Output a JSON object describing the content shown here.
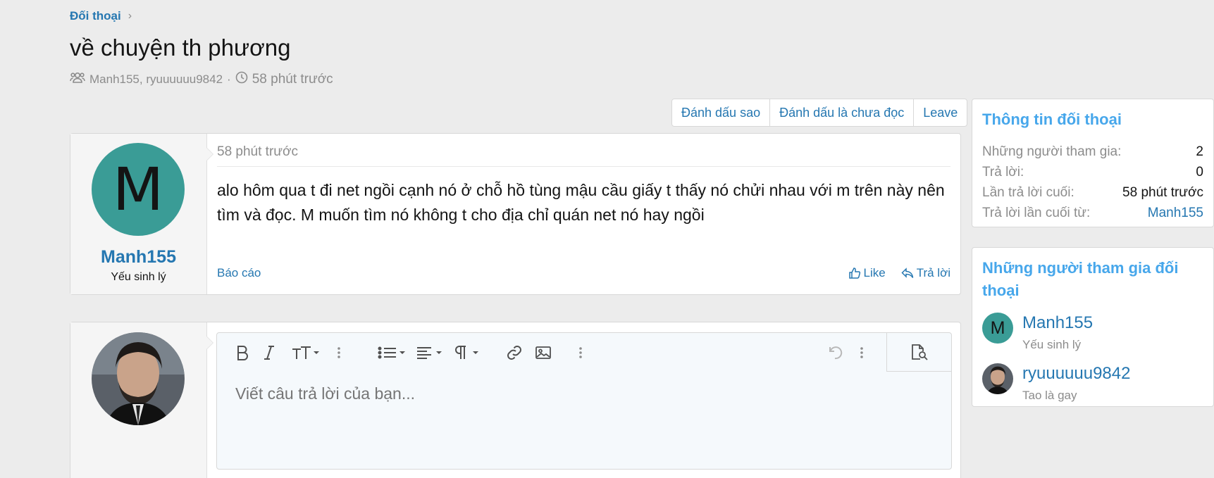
{
  "breadcrumb": {
    "label": "Đối thoại",
    "chevron": "›"
  },
  "page": {
    "title": "về chuyện th phương"
  },
  "meta": {
    "participants": "Manh155, ryuuuuuu9842",
    "separator": "·",
    "time": "58 phút trước"
  },
  "actions": [
    {
      "label": "Đánh dấu sao"
    },
    {
      "label": "Đánh dấu là chưa đọc"
    },
    {
      "label": "Leave"
    }
  ],
  "message": {
    "avatar_letter": "M",
    "username": "Manh155",
    "user_title": "Yếu sinh lý",
    "time": "58 phút trước",
    "body": "alo hôm qua t đi net ngồi cạnh nó ở chỗ hồ tùng mậu cầu giấy t thấy nó chửi nhau với m trên này nên tìm và đọc. M muốn tìm nó không t cho địa chỉ quán net nó hay ngồi",
    "report": "Báo cáo",
    "like": "Like",
    "reply": "Trả lời"
  },
  "editor": {
    "placeholder": "Viết câu trả lời của bạn...",
    "tools": [
      "bold-icon",
      "italic-icon",
      "text-size-icon",
      "more-vertical-icon",
      "list-icon",
      "align-icon",
      "paragraph-icon",
      "link-icon",
      "image-icon",
      "more-vertical-icon",
      "undo-icon",
      "more-vertical-icon",
      "preview-icon"
    ]
  },
  "info": {
    "title": "Thông tin đối thoại",
    "rows": [
      {
        "label": "Những người tham gia:",
        "value": "2"
      },
      {
        "label": "Trả lời:",
        "value": "0"
      },
      {
        "label": "Lần trả lời cuối:",
        "value": "58 phút trước"
      },
      {
        "label": "Trả lời lần cuối từ:",
        "value": "Manh155"
      }
    ]
  },
  "participants": {
    "title": "Những người tham gia đối thoại",
    "list": [
      {
        "letter": "M",
        "name": "Manh155",
        "title": "Yếu sinh lý"
      },
      {
        "name": "ryuuuuuu9842",
        "title": "Tao là gay"
      }
    ]
  },
  "colors": {
    "link": "#2577b1",
    "accent_title": "#47a7eb",
    "avatar_bg": "#3a9c96",
    "page_bg": "#ececec"
  }
}
